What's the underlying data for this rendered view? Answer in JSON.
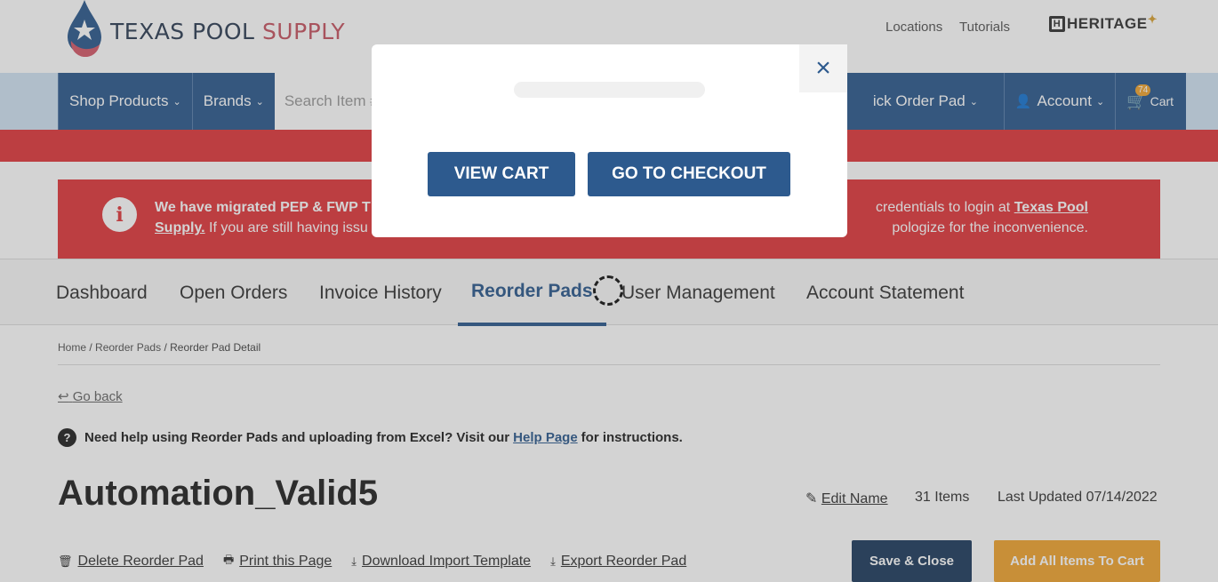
{
  "header": {
    "logo_text_1": "TEXAS POOL",
    "logo_text_2": "SUPPLY",
    "locations": "Locations",
    "tutorials": "Tutorials",
    "heritage": "HERITAGE",
    "heritage_initial": "H"
  },
  "nav": {
    "shop_products": "Shop Products",
    "brands": "Brands",
    "search_placeholder": "Search Item #",
    "quick_order": "ick Order Pad",
    "account": "Account",
    "cart": "Cart",
    "cart_count": "74"
  },
  "alert": {
    "bold_lead": "We have migrated PEP & FWP T",
    "mid1": "credentials to login at ",
    "link": "Texas Pool",
    "link2": "Supply.",
    "line2a": " If you are still having issu",
    "line2b": "pologize for the inconvenience."
  },
  "tabs": [
    "Dashboard",
    "Open Orders",
    "Invoice History",
    "Reorder Pads",
    "User Management",
    "Account Statement"
  ],
  "breadcrumb": {
    "home": "Home",
    "pads": "Reorder Pads",
    "current": "Reorder Pad Detail",
    "sep": "/"
  },
  "go_back": "Go back",
  "help": {
    "pre": "Need help using Reorder Pads and uploading from Excel? Visit our ",
    "link": "Help Page",
    "post": " for instructions."
  },
  "pad": {
    "title": "Automation_Valid5",
    "edit_name": "Edit Name",
    "items": "31 Items",
    "updated": "Last Updated 07/14/2022"
  },
  "actions": {
    "delete": "Delete Reorder Pad",
    "print": "Print this Page",
    "download": "Download Import Template",
    "export": "Export Reorder Pad"
  },
  "buttons": {
    "save_close": "Save & Close",
    "add_all": "Add All Items To Cart"
  },
  "modal": {
    "view_cart": "VIEW CART",
    "checkout": "GO TO CHECKOUT",
    "close": "×"
  },
  "colors": {
    "brand_blue": "#2d5a8e",
    "alert_red": "#e0393d",
    "accent_orange": "#f0a430"
  }
}
